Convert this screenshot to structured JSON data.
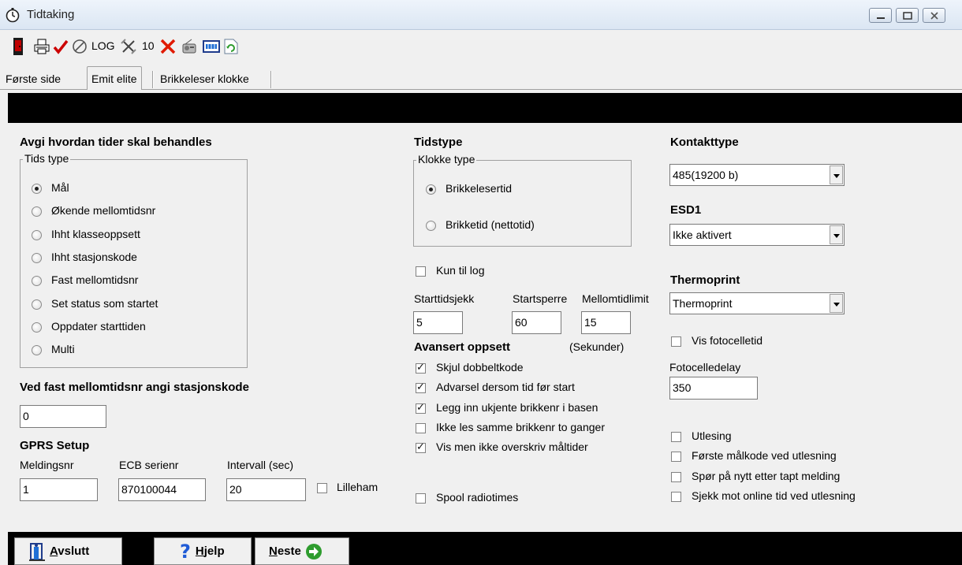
{
  "window": {
    "title": "Tidtaking",
    "icon": "stopwatch-icon"
  },
  "toolbar": {
    "log_label": "LOG",
    "ten_label": "10",
    "icons": [
      "exit-door-icon",
      "print-icon",
      "check-icon",
      "cancel-circle-icon",
      "log-icon",
      "tools-icon",
      "ten-icon",
      "delete-icon",
      "radio-icon",
      "keyboard-icon",
      "refresh-icon"
    ]
  },
  "tabs": [
    {
      "label": "Første side",
      "active": false
    },
    {
      "label": "Emit elite",
      "active": true
    },
    {
      "label": "Brikkeleser klokke",
      "active": false
    }
  ],
  "times": {
    "heading": "Avgi hvordan tider skal behandles",
    "group_label": "Tids type",
    "options": [
      "Mål",
      "Økende mellomtidsnr",
      "Ihht klasseoppsett",
      "Ihht stasjonskode",
      "Fast mellomtidsnr",
      "Set status som startet",
      "Oppdater starttiden",
      "Multi"
    ],
    "selected": "Mål"
  },
  "station": {
    "heading": "Ved fast mellomtidsnr angi stasjonskode",
    "value": "0"
  },
  "gprs": {
    "heading": "GPRS Setup",
    "meldingsnr_label": "Meldingsnr",
    "meldingsnr_value": "1",
    "ecb_label": "ECB serienr",
    "ecb_value": "870100044",
    "interval_label": "Intervall (sec)",
    "interval_value": "20",
    "lilleham_label": "Lilleham",
    "lilleham_checked": false
  },
  "tidstype": {
    "heading": "Tidstype",
    "group_label": "Klokke type",
    "options": [
      "Brikkelesertid",
      "Brikketid (nettotid)"
    ],
    "selected": "Brikkelesertid"
  },
  "log_only": {
    "label": "Kun til log",
    "checked": false
  },
  "limits": {
    "start_check_label": "Starttidsjekk",
    "start_check_value": "5",
    "start_block_label": "Startsperre",
    "start_block_value": "60",
    "split_limit_label": "Mellomtidlimit",
    "split_limit_value": "15",
    "unit_label": "(Sekunder)"
  },
  "advanced": {
    "heading": "Avansert oppsett",
    "options": [
      {
        "label": "Skjul dobbeltkode",
        "checked": true
      },
      {
        "label": "Advarsel dersom tid før start",
        "checked": true
      },
      {
        "label": "Legg inn ukjente brikkenr i basen",
        "checked": true
      },
      {
        "label": "Ikke les samme brikkenr to ganger",
        "checked": false
      },
      {
        "label": "Vis men ikke overskriv måltider",
        "checked": true
      }
    ]
  },
  "spool": {
    "label": "Spool radiotimes",
    "checked": false
  },
  "contact": {
    "heading": "Kontakttype",
    "value": "485(19200 b)",
    "esd_heading": "ESD1",
    "esd_value": "Ikke aktivert",
    "thermo_heading": "Thermoprint",
    "thermo_value": "Thermoprint",
    "photo_label": "Vis fotocelletid",
    "photo_checked": false,
    "photo_delay_label": "Fotocelledelay",
    "photo_delay_value": "350"
  },
  "readout": {
    "options": [
      {
        "label": "Utlesing",
        "checked": false
      },
      {
        "label": "Første målkode ved utlesning",
        "checked": false
      },
      {
        "label": "Spør på nytt etter tapt melding",
        "checked": false
      },
      {
        "label": "Sjekk mot online tid ved utlesning",
        "checked": false
      }
    ]
  },
  "buttons": {
    "exit_mnemonic": "A",
    "exit_rest": "vslutt",
    "help_mnemonic": "H",
    "help_rest": "jelp",
    "next_mnemonic": "N",
    "next_rest": "este"
  },
  "colors": {
    "bar": "#000000",
    "check_red": "#cc0000",
    "delete_red": "#e01a00",
    "next_green": "#2e9c2e",
    "help_blue": "#1f5bd6"
  }
}
